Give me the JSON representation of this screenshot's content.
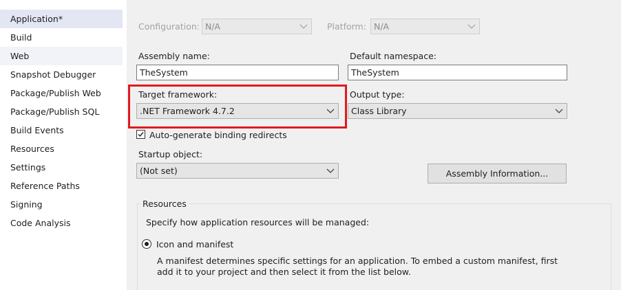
{
  "sidebar": {
    "items": [
      {
        "label": "Application*"
      },
      {
        "label": "Build"
      },
      {
        "label": "Web"
      },
      {
        "label": "Snapshot Debugger"
      },
      {
        "label": "Package/Publish Web"
      },
      {
        "label": "Package/Publish SQL"
      },
      {
        "label": "Build Events"
      },
      {
        "label": "Resources"
      },
      {
        "label": "Settings"
      },
      {
        "label": "Reference Paths"
      },
      {
        "label": "Signing"
      },
      {
        "label": "Code Analysis"
      }
    ]
  },
  "toolbar": {
    "configuration_label": "Configuration:",
    "configuration_value": "N/A",
    "platform_label": "Platform:",
    "platform_value": "N/A"
  },
  "form": {
    "assembly_name_label": "Assembly name:",
    "assembly_name_value": "TheSystem",
    "default_namespace_label": "Default namespace:",
    "default_namespace_value": "TheSystem",
    "target_framework_label": "Target framework:",
    "target_framework_value": ".NET Framework 4.7.2",
    "output_type_label": "Output type:",
    "output_type_value": "Class Library",
    "auto_generate_label": "Auto-generate binding redirects",
    "startup_object_label": "Startup object:",
    "startup_object_value": "(Not set)",
    "assembly_info_button": "Assembly Information..."
  },
  "resources": {
    "group_title": "Resources",
    "description": "Specify how application resources will be managed:",
    "icon_manifest_label": "Icon and manifest",
    "manifest_desc_line1": "A manifest determines specific settings for an application. To embed a custom manifest, first",
    "manifest_desc_line2": "add it to your project and then select it from the list below."
  },
  "colors": {
    "highlight": "#e0191f",
    "selected_nav": "#e3e6f3",
    "content_bg": "#f0f0f0"
  }
}
